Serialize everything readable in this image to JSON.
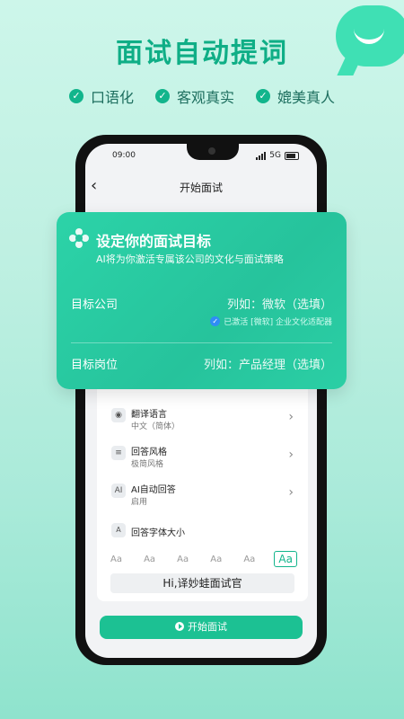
{
  "promo": {
    "headline": "面试自动提词",
    "features": [
      "口语化",
      "客观真实",
      "媲美真人"
    ]
  },
  "phone": {
    "status": {
      "time": "09:00",
      "network": "5G"
    },
    "nav": {
      "title": "开始面试"
    },
    "settings": {
      "hidden_row_tail": "...",
      "rows": [
        {
          "title": "翻译语言",
          "value": "中文（简体）",
          "icon": "globe-icon"
        },
        {
          "title": "回答风格",
          "value": "极简风格",
          "icon": "document-icon"
        },
        {
          "title": "AI自动回答",
          "value": "启用",
          "icon_text": "AI"
        }
      ],
      "font_size": {
        "title": "回答字体大小",
        "icon_text": "A",
        "options": [
          "Aa",
          "Aa",
          "Aa",
          "Aa",
          "Aa",
          "Aa"
        ],
        "selected_index": 5
      },
      "preview_text": "Hi,译妙蛙面试官"
    },
    "start_button": "开始面试"
  },
  "goal_card": {
    "title": "设定你的面试目标",
    "subtitle": "AI将为你激活专属该公司的文化与面试策略",
    "company": {
      "label": "目标公司",
      "placeholder": "列如：微软（选填）"
    },
    "activated": "已激活 [微软] 企业文化适配器",
    "position": {
      "label": "目标岗位",
      "placeholder": "列如：产品经理（选填）"
    }
  },
  "colors": {
    "accent": "#12b58c",
    "card": "#2cd3a8",
    "button": "#1cc193"
  }
}
